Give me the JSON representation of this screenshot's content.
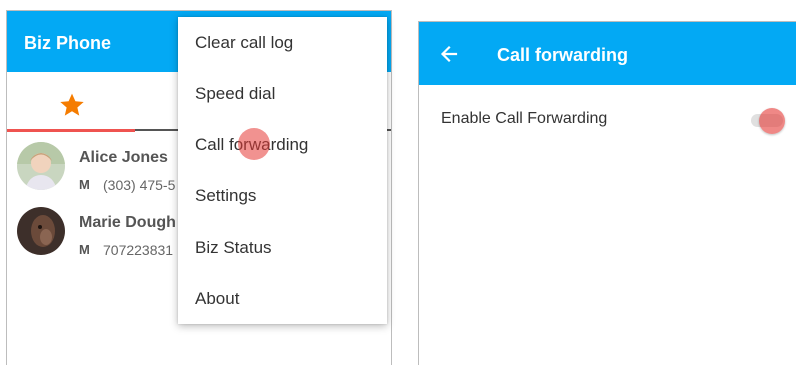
{
  "left_screen": {
    "app_title": "Biz Phone",
    "tabs": [
      {
        "icon": "star-icon",
        "selected": true
      }
    ],
    "contacts": [
      {
        "name": "Alice Jones",
        "type": "M",
        "number": "(303) 475-5"
      },
      {
        "name": "Marie Dough",
        "type": "M",
        "number": "707223831"
      }
    ],
    "menu": {
      "items": [
        {
          "label": "Clear call log"
        },
        {
          "label": "Speed dial"
        },
        {
          "label": "Call forwarding"
        },
        {
          "label": "Settings"
        },
        {
          "label": "Biz Status"
        },
        {
          "label": "About"
        }
      ]
    }
  },
  "right_screen": {
    "title": "Call forwarding",
    "back_icon": "arrow-left-icon",
    "settings": [
      {
        "label": "Enable Call Forwarding",
        "enabled": false
      }
    ]
  },
  "colors": {
    "header": "#03a9f4",
    "accent_star": "#f57c00",
    "tab_indicator": "#ef5350",
    "touch_dot": "#e53935"
  }
}
